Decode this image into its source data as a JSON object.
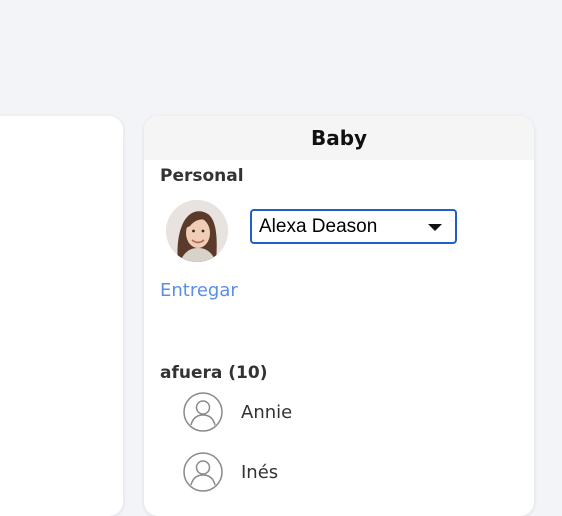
{
  "card": {
    "title": "Baby"
  },
  "personal": {
    "title": "Personal",
    "selected_person": "Alexa Deason",
    "submit_link": "Entregar"
  },
  "outside": {
    "title": "afuera (10)",
    "people": [
      {
        "name": "Annie"
      },
      {
        "name": "Inés"
      }
    ]
  },
  "colors": {
    "accent": "#1f5fc9",
    "link": "#5b8ee6",
    "background": "#f3f4f7",
    "card_header": "#f5f5f5"
  }
}
